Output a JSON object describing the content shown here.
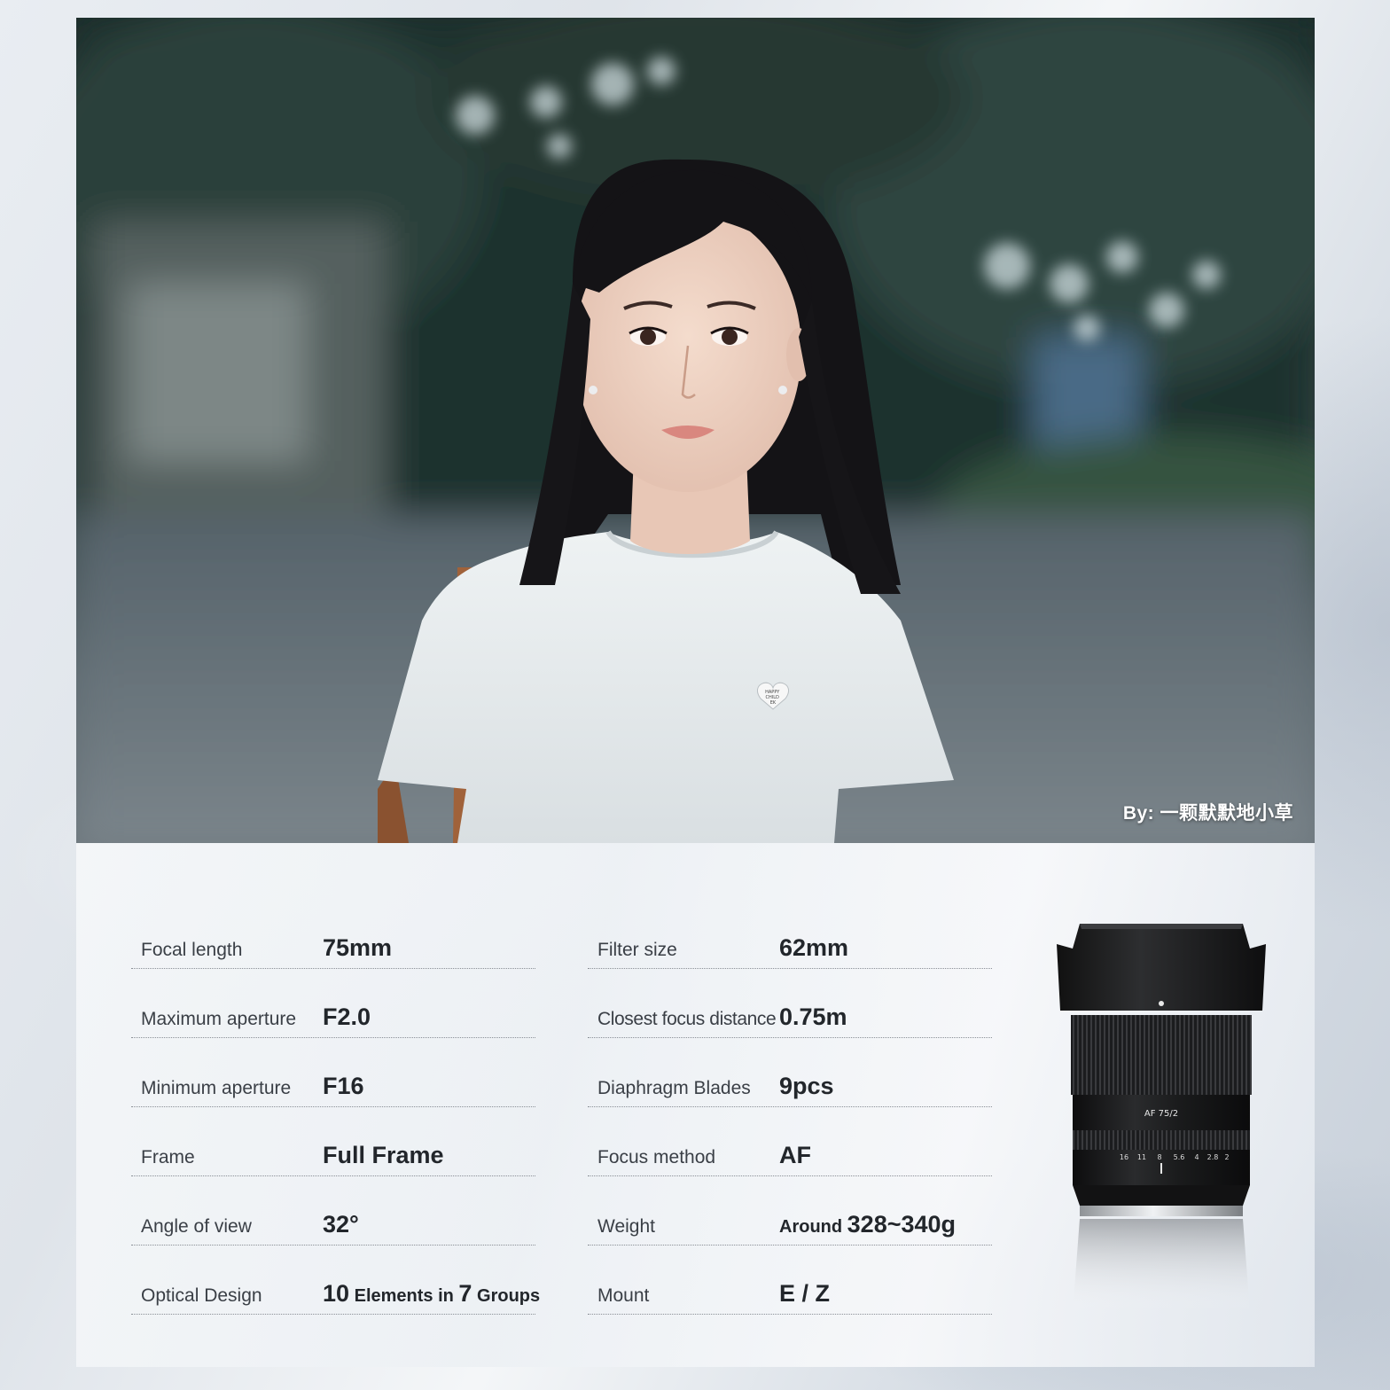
{
  "photo": {
    "credit": "By:  一颗默默地小草",
    "shirt_patch_lines": [
      "HAPPY",
      "CHILD",
      "EK"
    ]
  },
  "specs": {
    "left": [
      {
        "label": "Focal length",
        "value": "75mm"
      },
      {
        "label": "Maximum aperture",
        "value": "F2.0"
      },
      {
        "label": "Minimum aperture",
        "value": "F16"
      },
      {
        "label": "Frame",
        "value": "Full Frame"
      },
      {
        "label": "Angle of view",
        "value": "32°"
      },
      {
        "label": "Optical Design",
        "value_parts": [
          "10",
          " Elements in ",
          "7",
          " Groups"
        ]
      }
    ],
    "right": [
      {
        "label": "Filter size",
        "value": "62mm"
      },
      {
        "label": "Closest focus distance",
        "value": "0.75m"
      },
      {
        "label": "Diaphragm Blades",
        "value": "9pcs"
      },
      {
        "label": "Focus method",
        "value": "AF"
      },
      {
        "label": "Weight",
        "value_parts": [
          "Around ",
          "328~340g"
        ]
      },
      {
        "label": "Mount",
        "value": "E / Z"
      }
    ]
  },
  "lens": {
    "model_label": "AF 75/2",
    "aperture_scale": [
      "16",
      "11",
      "8",
      "5.6",
      "4",
      "2.8",
      "2"
    ]
  }
}
